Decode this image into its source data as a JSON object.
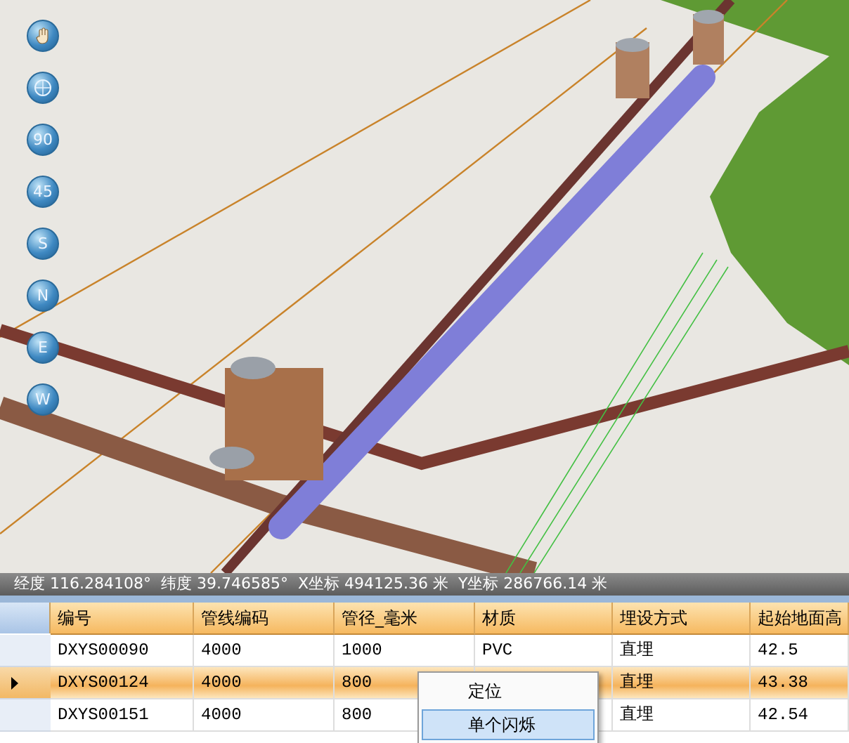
{
  "nav_buttons": [
    {
      "kind": "hand"
    },
    {
      "kind": "globe"
    },
    {
      "kind": "text",
      "label": "90"
    },
    {
      "kind": "text",
      "label": "45"
    },
    {
      "kind": "text",
      "label": "S"
    },
    {
      "kind": "text",
      "label": "N"
    },
    {
      "kind": "text",
      "label": "E"
    },
    {
      "kind": "text",
      "label": "W"
    }
  ],
  "status_bar": {
    "text": "经度 116.284108°  纬度 39.746585°  X坐标 494125.36 米  Y坐标 286766.14 米"
  },
  "table": {
    "columns": [
      "编号",
      "管线编码",
      "管径_毫米",
      "材质",
      "埋设方式",
      "起始地面高"
    ],
    "rows": [
      {
        "selected": false,
        "cells": [
          "DXYS00090",
          "4000",
          "1000",
          "PVC",
          "直埋",
          "42.5"
        ]
      },
      {
        "selected": true,
        "cells": [
          "DXYS00124",
          "4000",
          "800",
          "",
          "直埋",
          "43.38"
        ]
      },
      {
        "selected": false,
        "cells": [
          "DXYS00151",
          "4000",
          "800",
          "",
          "直埋",
          "42.54"
        ]
      }
    ]
  },
  "context_menu": {
    "items": [
      {
        "label": "定位",
        "selected": false
      },
      {
        "label": "单个闪烁",
        "selected": true
      }
    ]
  }
}
